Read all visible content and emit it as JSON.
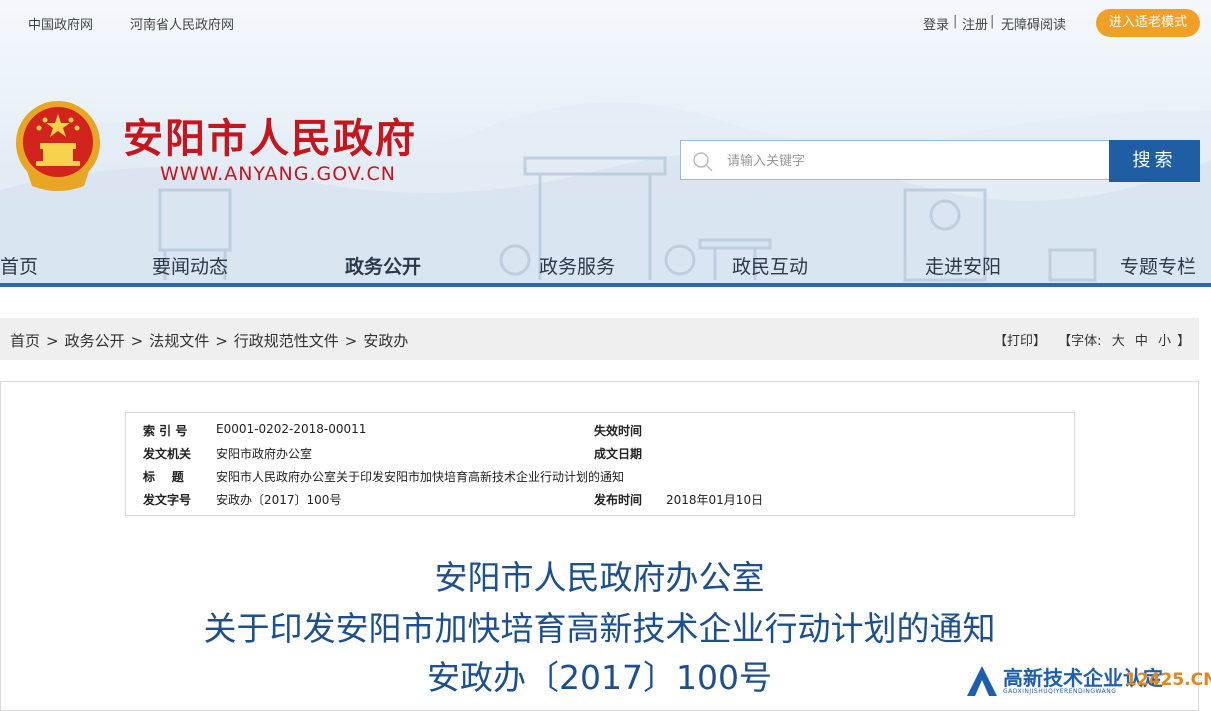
{
  "topbar": {
    "links_left": [
      "中国政府网",
      "河南省人民政府网"
    ],
    "login": "登录",
    "divider1": "|",
    "register": "注册",
    "divider2": "|",
    "accessible": "无障碍阅读",
    "elder_mode": "进入适老模式"
  },
  "site": {
    "title": "安阳市人民政府",
    "url": "WWW.ANYANG.GOV.CN"
  },
  "search": {
    "placeholder": "请输入关键字",
    "button": "搜索"
  },
  "nav": {
    "items": [
      "首页",
      "要闻动态",
      "政务公开",
      "政务服务",
      "政民互动",
      "走进安阳",
      "专题专栏"
    ],
    "active": "政务公开"
  },
  "breadcrumb": {
    "items": [
      "首页",
      "政务公开",
      "法规文件",
      "行政规范性文件",
      "安政办"
    ],
    "separator": ">"
  },
  "tools": {
    "print": "【打印】",
    "font_prefix": "【字体:",
    "large": "大",
    "medium": "中",
    "small": "小",
    "font_suffix": "】"
  },
  "meta": {
    "index_label": "索 引 号",
    "index_value": "E0001-0202-2018-00011",
    "expire_label": "失效时间",
    "expire_value": "",
    "issuer_label": "发文机关",
    "issuer_value": "安阳市政府办公室",
    "date_written_label": "成文日期",
    "date_written_value": "",
    "subject_label": "标    题",
    "subject_value": "安阳市人民政府办公室关于印发安阳市加快培育高新技术企业行动计划的通知",
    "docno_label": "发文字号",
    "docno_value": "安政办〔2017〕100号",
    "publish_label": "发布时间",
    "publish_value": "2018年01月10日"
  },
  "document": {
    "title_line1": "安阳市人民政府办公室",
    "title_line2": "关于印发安阳市加快培育高新技术企业行动计划的通知",
    "title_line3": "安政办〔2017〕100号"
  },
  "watermark": {
    "brand": "高新技术企业认定",
    "pinyin": "GAOXINJISHUQIYERENDINGWANG",
    "domain": "12425.CN"
  },
  "colors": {
    "brand_red": "#c4161c",
    "nav_blue": "#2b6aa8",
    "search_blue": "#1f5ea5",
    "elder_orange": "#f1a026",
    "title_blue": "#1c4f8c"
  }
}
